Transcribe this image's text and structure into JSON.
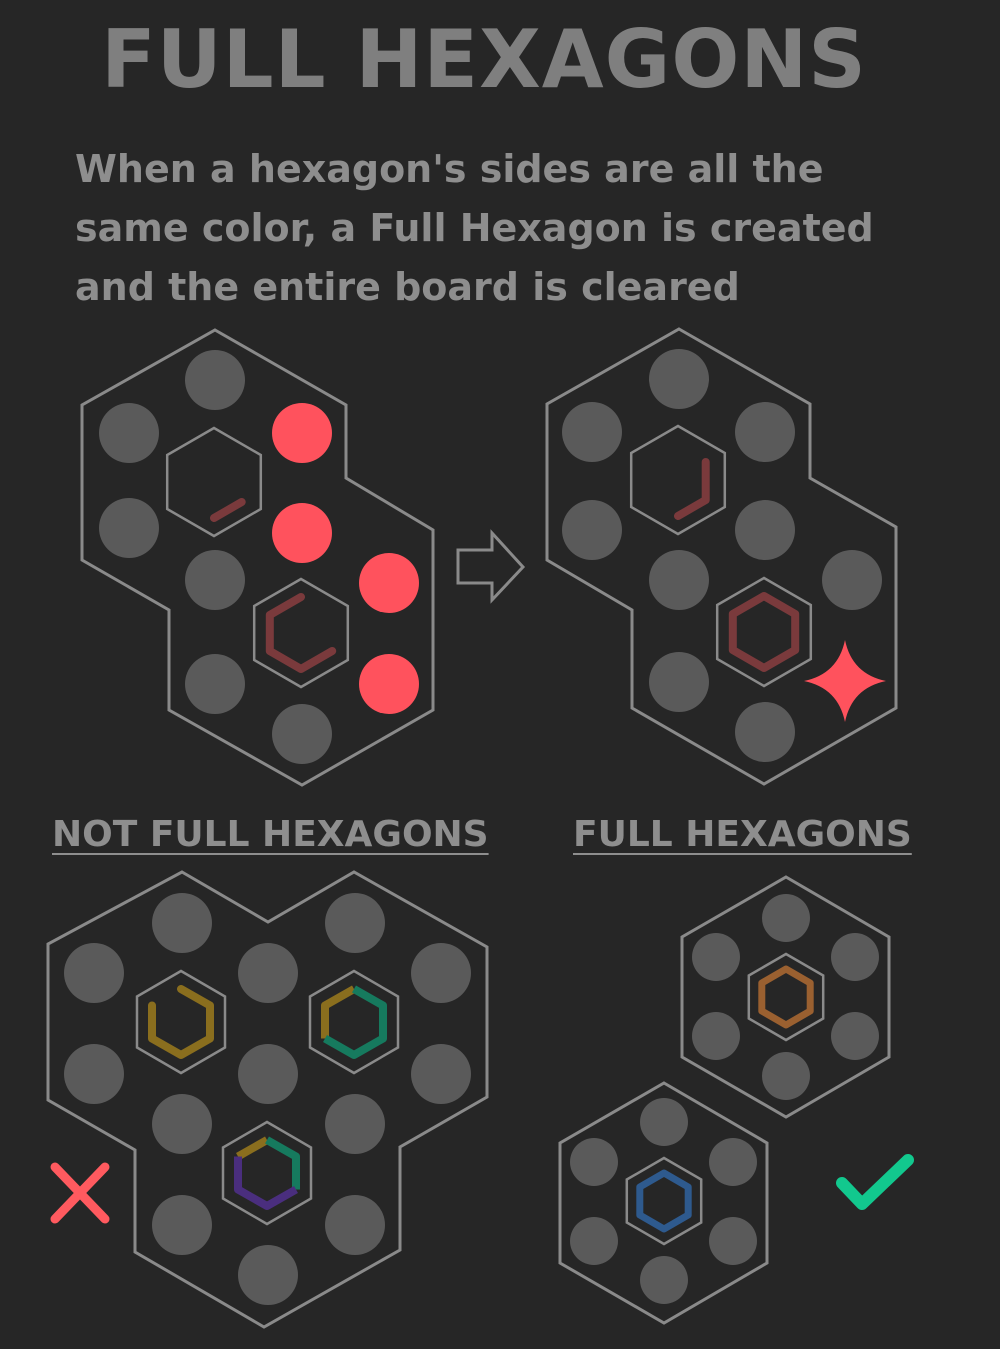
{
  "title": "FULL HEXAGONS",
  "description": "When a hexagon's sides are all the same color, a Full Hexagon is created and the entire board is cleared",
  "sections": {
    "not_full": "NOT FULL HEXAGONS",
    "full": "FULL HEXAGONS"
  },
  "colors": {
    "background": "#262626",
    "outline": "#8a8a8a",
    "slot": "#5a5a5a",
    "active_piece": "#ff525d",
    "dark_red_side": "#7a3a3c",
    "gold_side": "#8a6e1e",
    "teal_side": "#167a5e",
    "purple_side": "#4a2e7e",
    "orange_side": "#9a6030",
    "blue_side": "#2e5a8e",
    "cross": "#ff5a5f",
    "check": "#12c88e"
  },
  "icons": {
    "arrow": "arrow-right-icon",
    "sparkle": "sparkle-icon",
    "invalid": "cross-icon",
    "valid": "checkmark-icon"
  }
}
